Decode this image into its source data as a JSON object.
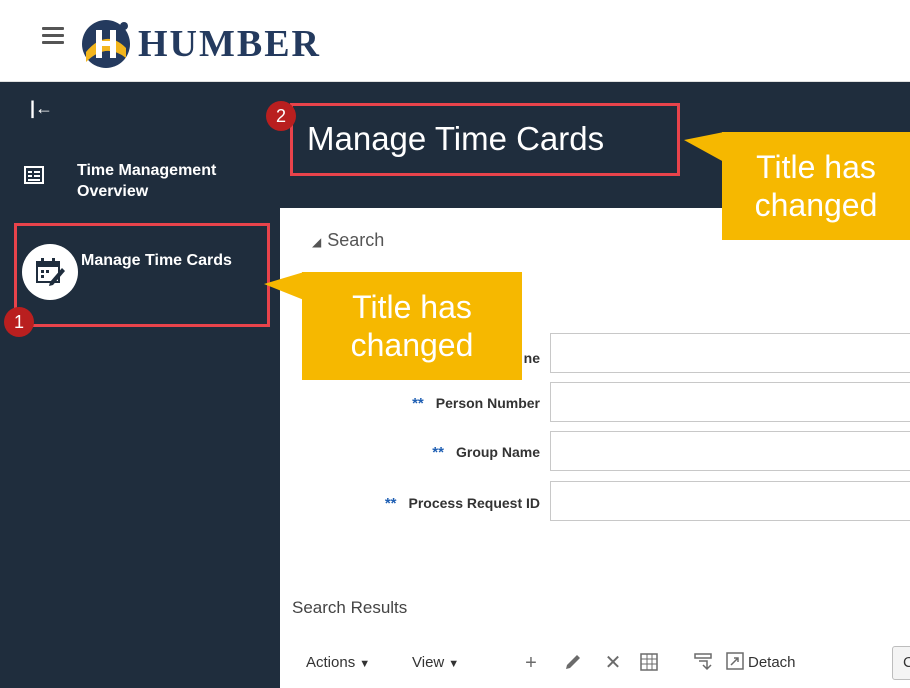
{
  "brand": {
    "name": "HUMBER"
  },
  "sidebar": {
    "items": [
      {
        "label": "Time Management Overview"
      },
      {
        "label": "Manage Time Cards"
      }
    ]
  },
  "page": {
    "title": "Manage Time Cards"
  },
  "search": {
    "heading": "Search",
    "fields": [
      {
        "label": "Person Name",
        "visible_fragment": "ne"
      },
      {
        "label": "Person Number",
        "required_marker": "**"
      },
      {
        "label": "Group Name",
        "required_marker": "**"
      },
      {
        "label": "Process Request ID",
        "required_marker": "**"
      }
    ]
  },
  "results": {
    "heading": "Search Results",
    "toolbar": {
      "actions": "Actions",
      "view": "View",
      "detach": "Detach",
      "partial_button": "C"
    }
  },
  "annotations": {
    "badge_1": "1",
    "badge_2": "2",
    "callout_1": "Title has changed",
    "callout_2": "Title has changed"
  },
  "colors": {
    "sidebar_bg": "#1f2d3d",
    "highlight_border": "#e8434b",
    "callout_bg": "#f6b800",
    "badge_bg": "#b91f1f",
    "brand_text": "#243a5e",
    "required_marker": "#1f5fb3"
  }
}
